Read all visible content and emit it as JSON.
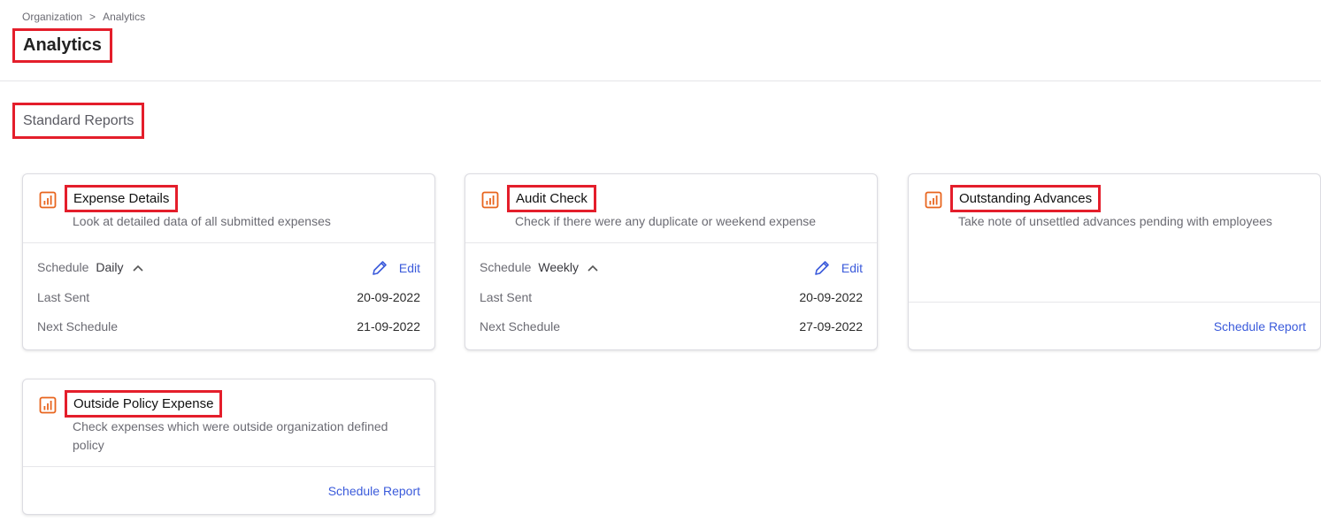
{
  "breadcrumb": {
    "root": "Organization",
    "separator": ">",
    "current": "Analytics"
  },
  "page_title": "Analytics",
  "section_title": "Standard Reports",
  "colors": {
    "accent": "#3b5bdb",
    "icon": "#e8651e",
    "highlight": "#e41e2b"
  },
  "cards": [
    {
      "icon": "bar-chart-icon",
      "title": "Expense Details",
      "description": "Look at detailed data of all submitted expenses",
      "schedule_label": "Schedule",
      "schedule_value": "Daily",
      "edit_label": "Edit",
      "last_sent_label": "Last Sent",
      "last_sent_value": "20-09-2022",
      "next_schedule_label": "Next Schedule",
      "next_schedule_value": "21-09-2022"
    },
    {
      "icon": "bar-chart-icon",
      "title": "Audit Check",
      "description": "Check if there were any duplicate or weekend expense",
      "schedule_label": "Schedule",
      "schedule_value": "Weekly",
      "edit_label": "Edit",
      "last_sent_label": "Last Sent",
      "last_sent_value": "20-09-2022",
      "next_schedule_label": "Next Schedule",
      "next_schedule_value": "27-09-2022"
    },
    {
      "icon": "bar-chart-icon",
      "title": "Outstanding Advances",
      "description": "Take note of unsettled advances pending with employees",
      "action_label": "Schedule Report"
    },
    {
      "icon": "bar-chart-icon",
      "title": "Outside Policy Expense",
      "description_line1": "Check expenses which were outside organization defined",
      "description_line2": "policy",
      "action_label": "Schedule Report"
    }
  ]
}
